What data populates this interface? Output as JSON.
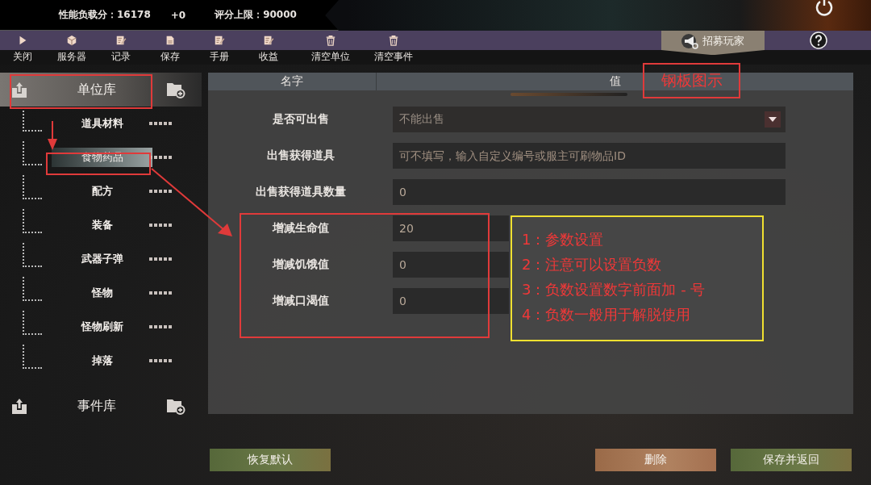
{
  "stats": {
    "load": "性能负载分：16178",
    "delta": "+0",
    "limit": "评分上限：90000"
  },
  "toolbar": [
    {
      "label": "关闭",
      "kind": "play"
    },
    {
      "label": "服务器",
      "kind": "cube"
    },
    {
      "label": "记录",
      "kind": "edit"
    },
    {
      "label": "保存",
      "kind": "file"
    },
    {
      "label": "手册",
      "kind": "edit"
    },
    {
      "label": "收益",
      "kind": "edit"
    },
    {
      "label": "清空单位",
      "kind": "trash"
    },
    {
      "label": "清空事件",
      "kind": "trash"
    }
  ],
  "recruit": "招募玩家",
  "sidebar": {
    "sections": [
      {
        "label": "单位库",
        "expanded": true,
        "children": [
          {
            "label": "道具材料",
            "selected": false
          },
          {
            "label": "食物药品",
            "selected": true
          },
          {
            "label": "配方",
            "selected": false
          },
          {
            "label": "装备",
            "selected": false
          },
          {
            "label": "武器子弹",
            "selected": false
          },
          {
            "label": "怪物",
            "selected": false
          },
          {
            "label": "怪物刷新",
            "selected": false
          },
          {
            "label": "掉落",
            "selected": false
          }
        ]
      },
      {
        "label": "事件库",
        "expanded": false
      }
    ]
  },
  "table": {
    "columns": [
      "名字",
      "值"
    ],
    "rows": [
      {
        "label": "是否可出售",
        "kind": "dropdown",
        "value": "不能出售"
      },
      {
        "label": "出售获得道具",
        "kind": "text",
        "placeholder": "可不填写，输入自定义编号或服主可刷物品ID"
      },
      {
        "label": "出售获得道具数量",
        "kind": "text",
        "value": "0"
      },
      {
        "label": "增减生命值",
        "kind": "text",
        "value": "20"
      },
      {
        "label": "增减饥饿值",
        "kind": "text",
        "value": "0"
      },
      {
        "label": "增减口渴值",
        "kind": "text",
        "value": "0"
      }
    ]
  },
  "buttons": [
    {
      "label": "恢复默认",
      "kind": "neutral"
    },
    {
      "label": "删除",
      "kind": "danger"
    },
    {
      "label": "保存并返回",
      "kind": "neutral"
    }
  ],
  "annotations": {
    "title": "钢板图示",
    "notes": [
      "1：参数设置",
      "2：注意可以设置负数",
      "3：负数设置数字前面加 - 号",
      "4：负数一般用于解脱使用"
    ]
  }
}
